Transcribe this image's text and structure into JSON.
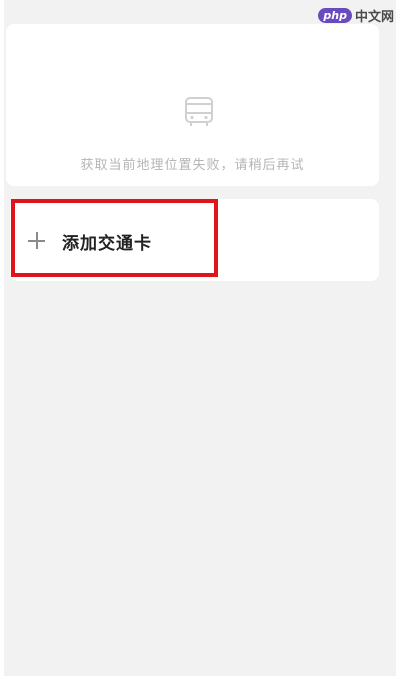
{
  "watermark": {
    "badge": "php",
    "text": "中文网"
  },
  "location_card": {
    "icon": "bus-icon",
    "message": "获取当前地理位置失败，请稍后再试"
  },
  "add_card": {
    "icon": "plus-icon",
    "label": "添加交通卡"
  },
  "colors": {
    "background": "#f2f2f2",
    "card": "#ffffff",
    "highlight": "#e0141c",
    "muted_text": "#b5b5b5",
    "watermark_badge": "#6a4bbf"
  }
}
